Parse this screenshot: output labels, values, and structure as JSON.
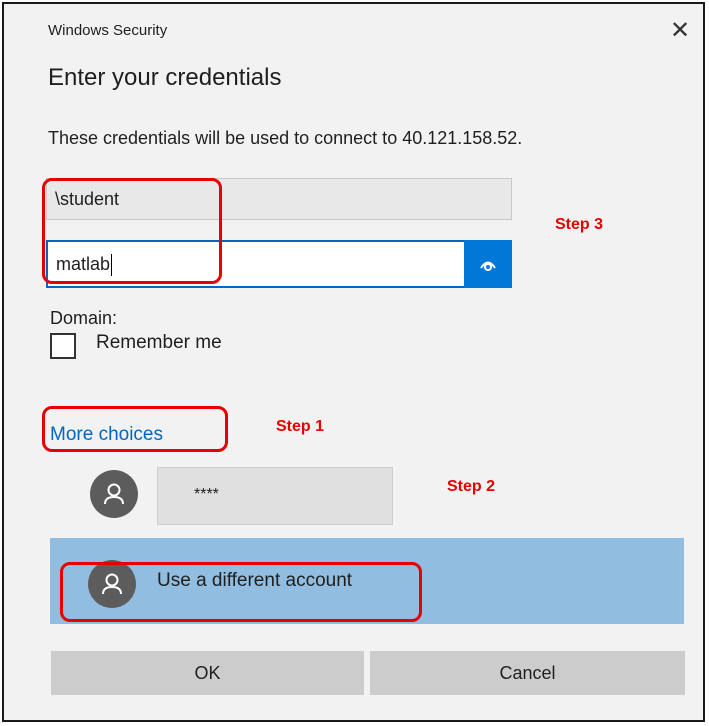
{
  "dialog": {
    "window_title": "Windows Security",
    "close_glyph": "✕",
    "heading": "Enter your credentials",
    "description": "These credentials will be used to connect to 40.121.158.52."
  },
  "fields": {
    "username_value": "\\student",
    "password_value": "matlab",
    "reveal_icon": "eye-icon"
  },
  "domain_label": "Domain:",
  "remember_label": "Remember me",
  "more_choices_label": "More choices",
  "saved_credential": {
    "masked_value": "****",
    "icon": "user-icon"
  },
  "different_account": {
    "label": "Use a different account",
    "icon": "user-icon"
  },
  "buttons": {
    "ok": "OK",
    "cancel": "Cancel"
  },
  "annotations": {
    "step1": "Step 1",
    "step2": "Step 2",
    "step3": "Step 3",
    "highlight_color": "#e60000"
  },
  "colors": {
    "accent": "#0078d7",
    "link": "#0067c0",
    "selected_row": "#91bde0"
  }
}
